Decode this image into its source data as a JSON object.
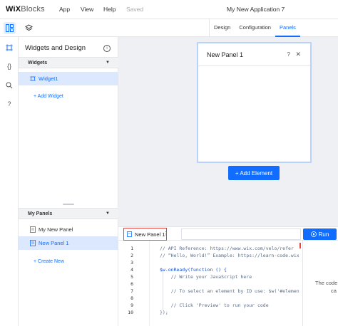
{
  "topbar": {
    "logo_bold": "WiX",
    "logo_rest": "Blocks",
    "menu": [
      "App",
      "View",
      "Help"
    ],
    "saved_status": "Saved",
    "app_title": "My New Application 7"
  },
  "tabs": [
    {
      "label": "Design",
      "active": false
    },
    {
      "label": "Configuration",
      "active": false
    },
    {
      "label": "Panels",
      "active": true
    }
  ],
  "left_panel": {
    "title": "Widgets and Design",
    "info_glyph": "i",
    "widgets_section": "Widgets",
    "widgets": [
      {
        "label": "Widget1",
        "selected": true
      }
    ],
    "add_widget": "+ Add Widget",
    "panels_section": "My Panels",
    "panels": [
      {
        "label": "My New Panel",
        "selected": false
      },
      {
        "label": "New Panel 1",
        "selected": true
      }
    ],
    "create_new": "+ Create New"
  },
  "canvas": {
    "panel_title": "New Panel 1",
    "help_glyph": "?",
    "close_glyph": "✕",
    "add_element": "+ Add Element"
  },
  "code": {
    "file_tab": "New Panel 1",
    "run_label": "Run",
    "line_numbers": [
      "1",
      "2",
      "3",
      "4",
      "5",
      "6",
      "7",
      "8",
      "9",
      "10"
    ],
    "lines": [
      "// API Reference: https://www.wix.com/velo/refer",
      "// “Hello, World!” Example: https://learn-code.wix",
      "",
      "$w.onReady(function () {",
      "    // Write your JavaScript here",
      "",
      "    // To select an element by ID use: $w('#elemen",
      "",
      "    // Click 'Preview' to run your code",
      "});"
    ],
    "side_text_1": "The code",
    "side_text_2": "ca"
  },
  "colors": {
    "accent": "#116dff",
    "selected_bg": "#dbe8fd",
    "highlight_border": "#e8423a"
  }
}
